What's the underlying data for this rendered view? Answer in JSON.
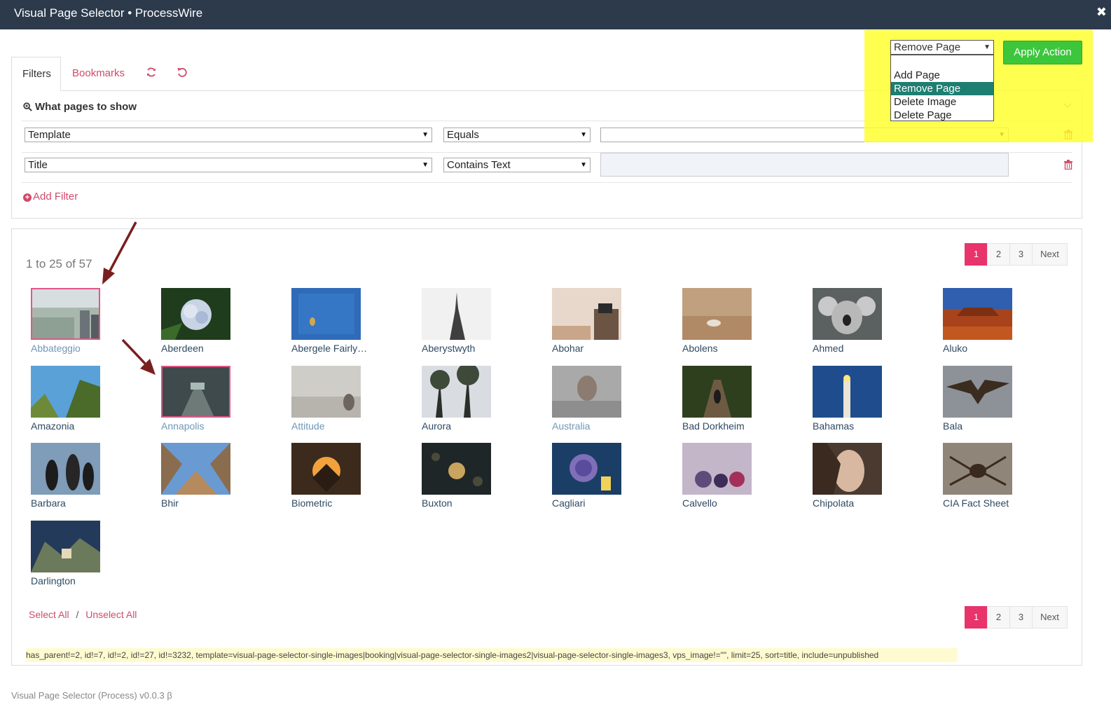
{
  "window": {
    "title": "Visual Page Selector • ProcessWire",
    "close_glyph": "✖"
  },
  "tabs": {
    "filters": "Filters",
    "bookmarks": "Bookmarks"
  },
  "filters": {
    "heading": "What pages to show",
    "rows": [
      {
        "field": "Template",
        "operator": "Equals",
        "value": ""
      },
      {
        "field": "Title",
        "operator": "Contains Text",
        "value": ""
      }
    ],
    "add_label": "Add Filter"
  },
  "actions": {
    "selected": "Remove Page",
    "options": [
      "Add Page",
      "Remove Page",
      "Delete Image",
      "Delete Page"
    ],
    "apply_label": "Apply Action"
  },
  "results": {
    "count_text": "1 to 25 of 57",
    "pages": [
      "1",
      "2",
      "3"
    ],
    "next_label": "Next",
    "items": [
      {
        "label": "Abbateggio",
        "selected": true,
        "muted": true
      },
      {
        "label": "Aberdeen"
      },
      {
        "label": "Abergele Fairly…"
      },
      {
        "label": "Aberystwyth"
      },
      {
        "label": "Abohar"
      },
      {
        "label": "Abolens"
      },
      {
        "label": "Ahmed"
      },
      {
        "label": "Aluko"
      },
      {
        "label": "Amazonia"
      },
      {
        "label": "Annapolis",
        "selected": true,
        "muted": true
      },
      {
        "label": "Attitude",
        "muted": true
      },
      {
        "label": "Aurora"
      },
      {
        "label": "Australia",
        "muted": true
      },
      {
        "label": "Bad Dorkheim"
      },
      {
        "label": "Bahamas"
      },
      {
        "label": "Bala"
      },
      {
        "label": "Barbara"
      },
      {
        "label": "Bhir"
      },
      {
        "label": "Biometric"
      },
      {
        "label": "Buxton"
      },
      {
        "label": "Cagliari"
      },
      {
        "label": "Calvello"
      },
      {
        "label": "Chipolata"
      },
      {
        "label": "CIA Fact Sheet"
      },
      {
        "label": "Darlington"
      }
    ],
    "select_all": "Select All",
    "separator": "/",
    "unselect_all": "Unselect All",
    "selector": "has_parent!=2, id!=7, id!=2, id!=27, id!=3232, template=visual-page-selector-single-images|booking|visual-page-selector-single-images2|visual-page-selector-single-images3, vps_image!=\"\", limit=25, sort=title, include=unpublished"
  },
  "footer": "Visual Page Selector (Process) v0.0.3 β"
}
